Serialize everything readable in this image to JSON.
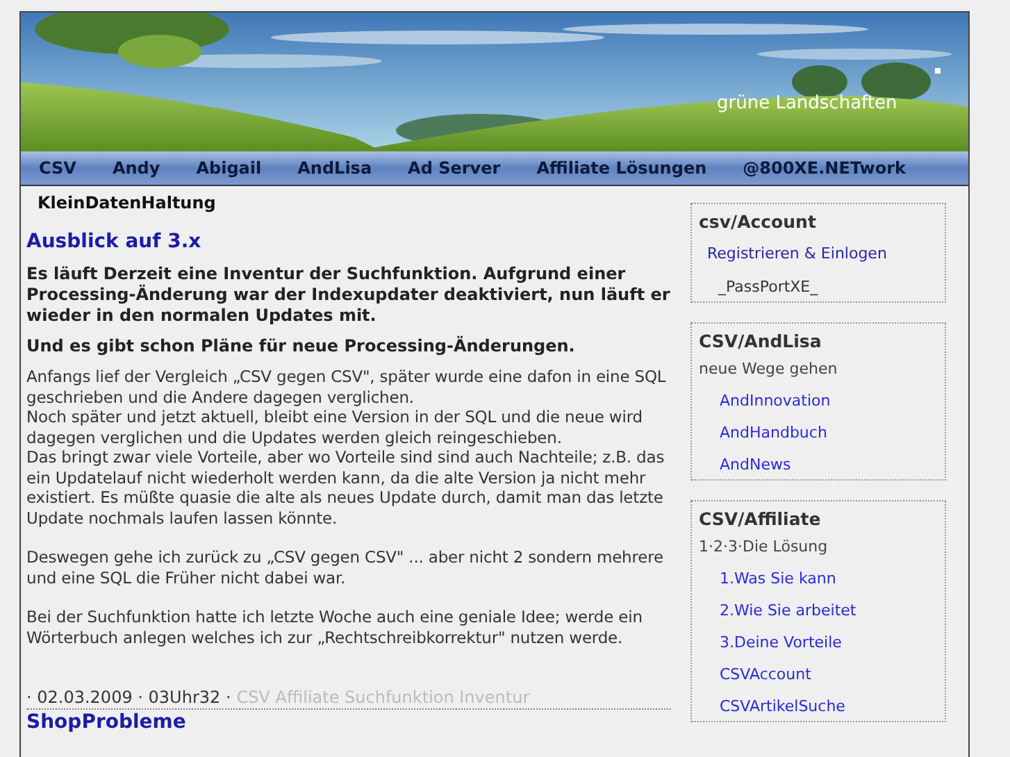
{
  "header": {
    "site_title": "grüne Landschaften"
  },
  "nav": [
    {
      "label": "CSV"
    },
    {
      "label": "Andy"
    },
    {
      "label": "Abigail"
    },
    {
      "label": "AndLisa"
    },
    {
      "label": "Ad Server"
    },
    {
      "label": "Affiliate Lösungen"
    },
    {
      "label": "@800XE.NETwork"
    }
  ],
  "breadcrumb": "KleinDatenHaltung",
  "posts": [
    {
      "title": "Ausblick auf 3.x",
      "lead": [
        "Es läuft Derzeit eine Inventur der Suchfunktion. Aufgrund einer Processing-Änderung war der Indexupdater deaktiviert, nun läuft er wieder in den normalen Updates mit.",
        "Und es gibt schon Pläne für neue Processing-Änderungen."
      ],
      "body": [
        "Anfangs lief der Vergleich „CSV gegen CSV\", später wurde eine dafon in eine SQL geschrieben und die Andere dagegen verglichen.\nNoch später und jetzt aktuell, bleibt eine Version in der SQL und die neue wird dagegen verglichen und die Updates werden gleich reingeschieben.\nDas bringt zwar viele Vorteile, aber wo Vorteile sind sind auch Nachteile; z.B. das ein Updatelauf nicht wiederholt werden kann, da die alte Version ja nicht mehr existiert. Es müßte quasie die alte als neues Update durch, damit man das letzte Update nochmals laufen lassen könnte.",
        "Deswegen gehe ich zurück zu „CSV gegen CSV\" ... aber nicht 2 sondern mehrere und eine SQL die Früher nicht dabei war.",
        "Bei der Suchfunktion hatte ich letzte Woche auch eine geniale Idee; werde ein Wörterbuch anlegen welches ich zur „Rechtschreibkorrektur\" nutzen werde."
      ],
      "date": "· 02.03.2009 · 03Uhr32 ·",
      "tags": "CSV Affiliate Suchfunktion Inventur"
    },
    {
      "title": "ShopProbleme"
    }
  ],
  "sidebar": [
    {
      "title": "csv/Account",
      "items": [
        {
          "text": "Registrieren & Einlogen",
          "kind": "link"
        },
        {
          "text": "_PassPortXE_",
          "kind": "subtext"
        }
      ]
    },
    {
      "title": "CSV/AndLisa",
      "items": [
        {
          "text": "neue Wege gehen",
          "kind": "text"
        },
        {
          "text": "AndInnovation",
          "kind": "sublink"
        },
        {
          "text": "AndHandbuch",
          "kind": "sublink"
        },
        {
          "text": "AndNews",
          "kind": "sublink"
        }
      ]
    },
    {
      "title": "CSV/Affiliate",
      "items": [
        {
          "text": "1·2·3·Die Lösung",
          "kind": "text"
        },
        {
          "text": "1.Was Sie kann",
          "kind": "sublink"
        },
        {
          "text": "2.Wie Sie arbeitet",
          "kind": "sublink"
        },
        {
          "text": "3.Deine Vorteile",
          "kind": "sublink"
        },
        {
          "text": "CSVAccount",
          "kind": "sublink"
        },
        {
          "text": "CSVArtikelSuche",
          "kind": "sublink"
        }
      ]
    }
  ]
}
